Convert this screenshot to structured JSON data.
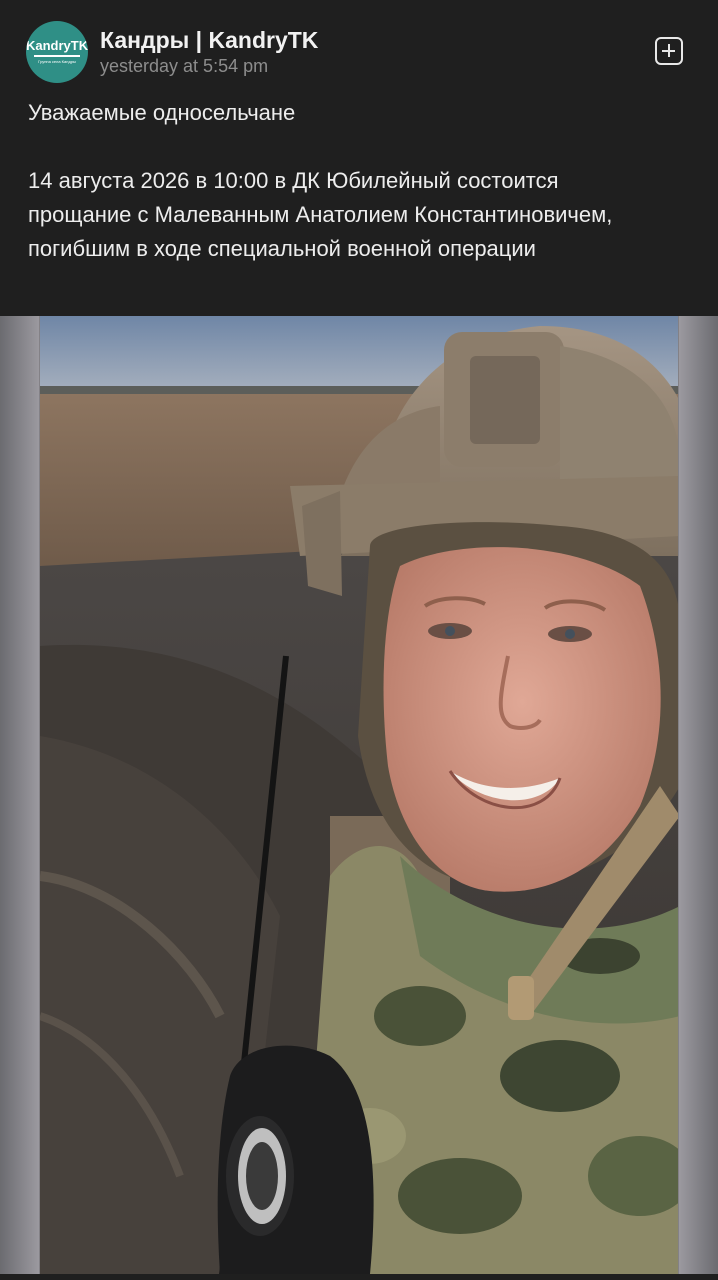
{
  "post": {
    "author": "Кандры | KandryTK",
    "time": "yesterday at 5:54 pm",
    "avatar": {
      "brand": "KandryTK",
      "subtitle": "Группа села Кандры"
    },
    "text": {
      "greeting": "Уважаемые односельчане",
      "body": "14 августа 2026 в 10:00 в ДК Юбилейный состоится прощание с Малеванным Анатолием Константиновичем, погибшим в ходе специальной военной операции"
    },
    "photo": {
      "subject": "selfie-soldier-in-helmet-in-field"
    }
  },
  "colors": {
    "background": "#1f1f1f",
    "avatar": "#2f8f86",
    "text": "#ededed",
    "meta": "#8d8d8d"
  }
}
